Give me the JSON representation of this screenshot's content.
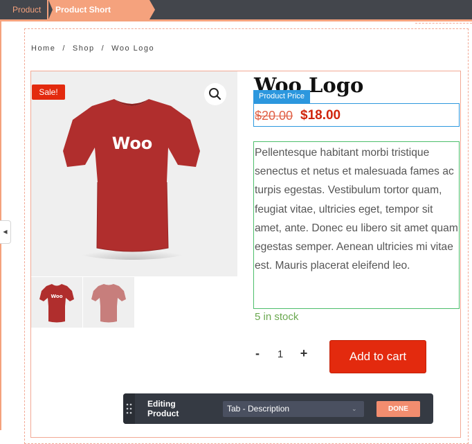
{
  "builder": {
    "breadcrumb_tabs": [
      "Product",
      "Product Short Description"
    ]
  },
  "breadcrumb": {
    "items": [
      "Home",
      "/",
      "Shop",
      "/",
      "Woo Logo"
    ]
  },
  "product": {
    "sale_badge": "Sale!",
    "title": "Woo Logo",
    "price_module_label": "Product Price",
    "old_price": "$20.00",
    "new_price": "$18.00",
    "short_description": "Pellentesque habitant morbi tristique senectus et netus et malesuada fames ac turpis egestas. Vestibulum tortor quam, feugiat vitae, ultricies eget, tempor sit amet, ante. Donec eu libero sit amet quam egestas semper. Aenean ultricies mi vitae est. Mauris placerat eleifend leo.",
    "stock": "5 in stock",
    "quantity": {
      "minus": "-",
      "value": "1",
      "plus": "+"
    },
    "add_to_cart_label": "Add to cart",
    "shirt_text": "Woo"
  },
  "editor_bar": {
    "editing_label_line1": "Editing",
    "editing_label_line2": "Product",
    "tab_select_value": "Tab - Description",
    "done_label": "DONE"
  },
  "colors": {
    "accent": "#f5a27d",
    "sale": "#e32a0e",
    "price_outline": "#2c97de",
    "desc_outline": "#4bbd6a",
    "shirt": "#b02e2d"
  },
  "icons": [
    "search-icon",
    "drag-handle-icon",
    "chevron-down-icon",
    "collapse-left-icon"
  ]
}
